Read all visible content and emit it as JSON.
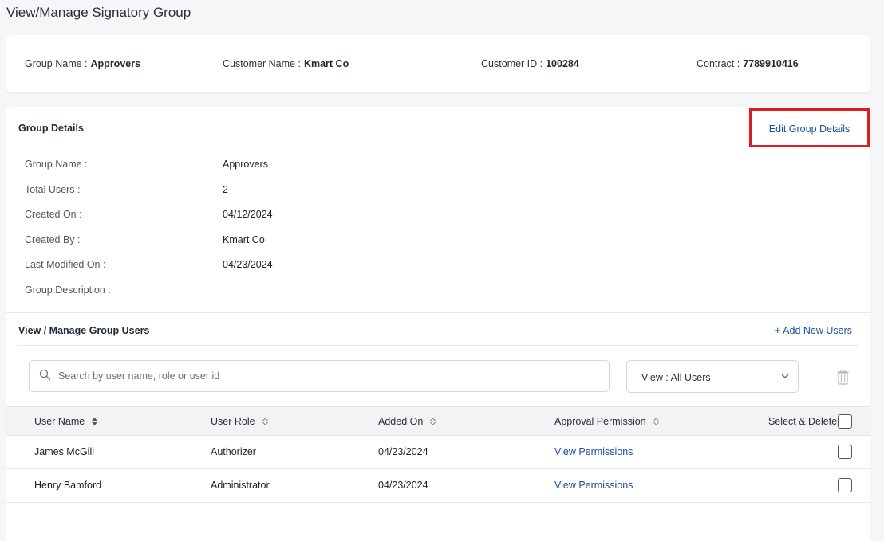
{
  "page": {
    "title": "View/Manage Signatory Group"
  },
  "summary": {
    "group_name_label": "Group Name :",
    "group_name_value": "Approvers",
    "customer_name_label": "Customer Name :",
    "customer_name_value": "Kmart Co",
    "customer_id_label": "Customer ID :",
    "customer_id_value": "100284",
    "contract_label": "Contract :",
    "contract_value": "7789910416"
  },
  "group_details": {
    "title": "Group Details",
    "edit_label": "Edit Group Details",
    "fields": [
      {
        "label": "Group Name :",
        "value": "Approvers"
      },
      {
        "label": "Total Users :",
        "value": "2"
      },
      {
        "label": "Created On :",
        "value": "04/12/2024"
      },
      {
        "label": "Created By :",
        "value": "Kmart Co"
      },
      {
        "label": "Last Modified On :",
        "value": "04/23/2024"
      },
      {
        "label": "Group Description :",
        "value": ""
      }
    ]
  },
  "users": {
    "title": "View / Manage Group Users",
    "add_label": "+ Add New Users",
    "search_placeholder": "Search by user name, role or user id",
    "view_filter_label": "View :",
    "view_filter_value": "All Users",
    "columns": [
      "User Name",
      "User Role",
      "Added On",
      "Approval Permission",
      "Select & Delete"
    ],
    "rows": [
      {
        "name": "James McGill",
        "role": "Authorizer",
        "added_on": "04/23/2024",
        "permission": "View Permissions"
      },
      {
        "name": "Henry Bamford",
        "role": "Administrator",
        "added_on": "04/23/2024",
        "permission": "View Permissions"
      }
    ]
  },
  "icons": {
    "search": "search-icon",
    "chevron": "chevron-down-icon",
    "trash": "trash-icon",
    "sort": "sort-icon"
  },
  "colors": {
    "link": "#1a4f9c",
    "highlight": "#e21b23"
  }
}
